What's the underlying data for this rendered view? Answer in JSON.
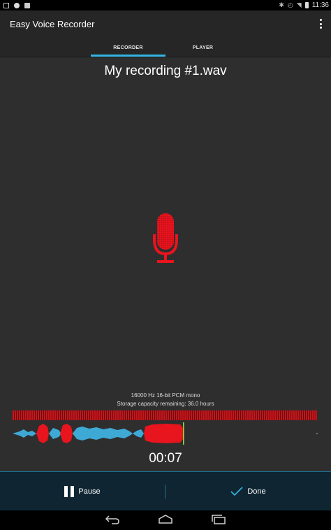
{
  "status_bar": {
    "time": "11:36"
  },
  "app": {
    "title": "Easy Voice Recorder"
  },
  "tabs": [
    {
      "label": "RECORDER",
      "selected": true
    },
    {
      "label": "PLAYER",
      "selected": false
    }
  ],
  "recording": {
    "file_name": "My recording #1.wav",
    "format": "16000 Hz 16-bit PCM mono",
    "storage": "Storage capacity remaining: 36.0 hours",
    "elapsed": "00:07"
  },
  "controls": {
    "pause_label": "Pause",
    "done_label": "Done"
  },
  "colors": {
    "accent": "#33b5e5",
    "record_red": "#e8141e",
    "waveform_blue": "#3fa9d6",
    "playhead_green": "#8ee03a"
  },
  "icons": [
    "microphone-icon",
    "pause-icon",
    "checkmark-icon",
    "overflow-menu-icon",
    "back-icon",
    "home-icon",
    "recent-apps-icon"
  ]
}
